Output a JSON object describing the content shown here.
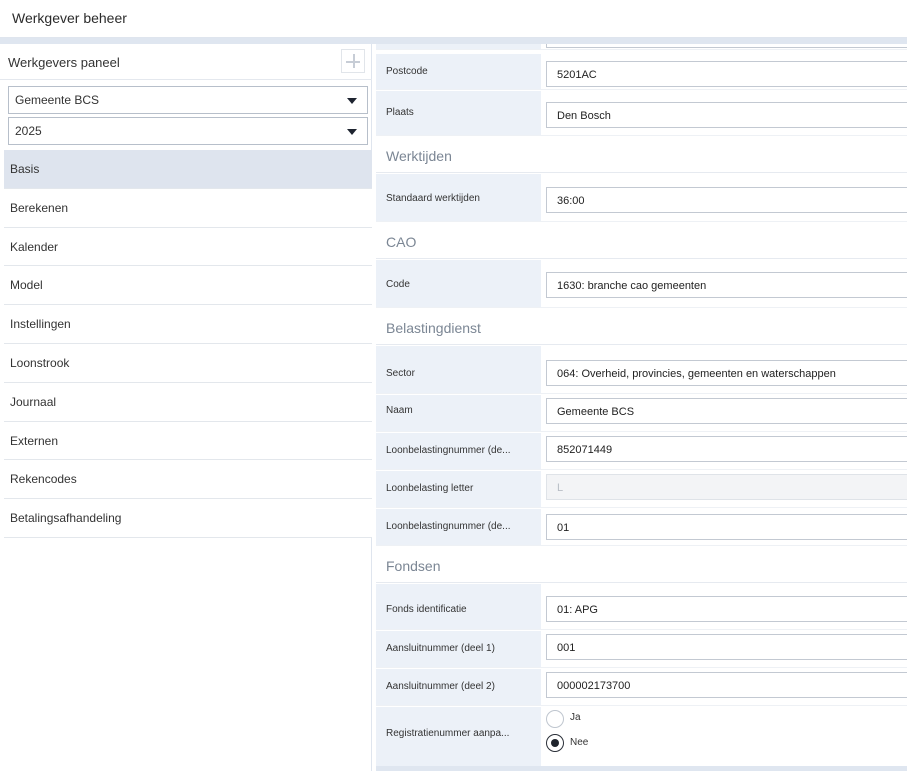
{
  "window": {
    "title": "Werkgever beheer"
  },
  "left_panel": {
    "header": "Werkgevers paneel",
    "add_icon": "plus-icon",
    "employer_select": "Gemeente BCS",
    "year_select": "2025",
    "nav": [
      {
        "label": "Basis",
        "active": true
      },
      {
        "label": "Berekenen"
      },
      {
        "label": "Kalender"
      },
      {
        "label": "Model"
      },
      {
        "label": "Instellingen"
      },
      {
        "label": "Loonstrook"
      },
      {
        "label": "Journaal"
      },
      {
        "label": "Externen"
      },
      {
        "label": "Rekencodes"
      },
      {
        "label": "Betalingsafhandeling"
      }
    ]
  },
  "form": {
    "address": {
      "postcode_label": "Postcode",
      "postcode_value": "5201AC",
      "plaats_label": "Plaats",
      "plaats_value": "Den Bosch"
    },
    "werktijden": {
      "title": "Werktijden",
      "standaard_label": "Standaard werktijden",
      "standaard_value": "36:00"
    },
    "cao": {
      "title": "CAO",
      "code_label": "Code",
      "code_value": "1630: branche cao gemeenten"
    },
    "belastingdienst": {
      "title": "Belastingdienst",
      "sector_label": "Sector",
      "sector_value": "064: Overheid, provincies, gemeenten en waterschappen",
      "naam_label": "Naam",
      "naam_value": "Gemeente BCS",
      "lbn1_label": "Loonbelastingnummer (de...",
      "lbn1_value": "852071449",
      "letter_label": "Loonbelasting letter",
      "letter_value": "L",
      "lbn2_label": "Loonbelastingnummer (de...",
      "lbn2_value": "01"
    },
    "fondsen": {
      "title": "Fondsen",
      "fonds_label": "Fonds identificatie",
      "fonds_value": "01: APG",
      "aans1_label": "Aansluitnummer (deel 1)",
      "aans1_value": "001",
      "aans2_label": "Aansluitnummer (deel 2)",
      "aans2_value": "000002173700",
      "reg_label": "Registratienummer aanpa...",
      "reg_options": [
        "Ja",
        "Nee"
      ],
      "reg_selected": "Nee"
    }
  }
}
